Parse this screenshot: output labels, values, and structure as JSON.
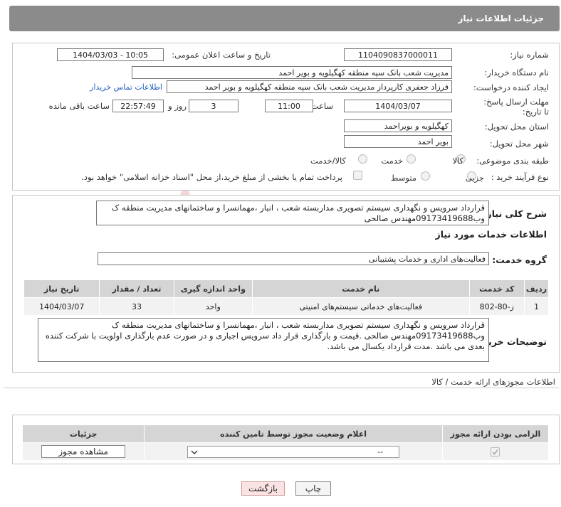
{
  "header": {
    "title": "جزئیات اطلاعات نیاز"
  },
  "form": {
    "need_number_label": "شماره نیاز:",
    "need_number": "1104090837000011",
    "announce_label": "تاریخ و ساعت اعلان عمومی:",
    "announce_value": "1404/03/03 - 10:05",
    "buyer_org_label": "نام دستگاه خریدار:",
    "buyer_org": "مدیریت شعب بانک سپه منطقه کهگیلویه و بویر احمد",
    "requester_label": "ایجاد کننده درخواست:",
    "requester": "فرزاد جعفری کارپرداز مدیریت شعب بانک سپه منطقه کهگیلویه و بویر احمد",
    "contact_link": "اطلاعات تماس خریدار",
    "deadline_label": "مهلت ارسال پاسخ: تا تاریخ:",
    "deadline_date": "1404/03/07",
    "time_label": "ساعت",
    "deadline_time": "11:00",
    "days_value": "3",
    "days_label": "روز و",
    "remaining_time": "22:57:49",
    "remaining_label": "ساعت باقی مانده",
    "province_label": "استان محل تحویل:",
    "province": "کهگیلویه و بویراحمد",
    "city_label": "شهر محل تحویل:",
    "city": "بویر احمد",
    "category_label": "طبقه بندی موضوعی:",
    "category_options": [
      "کالا",
      "خدمت",
      "کالا/خدمت"
    ],
    "process_label": "نوع فرآیند خرید :",
    "process_options": [
      "جزیی",
      "متوسط"
    ],
    "payment_note": "پرداخت تمام یا بخشی از مبلغ خرید،از محل \"اسناد خزانه اسلامی\" خواهد بود."
  },
  "description": {
    "label": "شرح کلی نیاز:",
    "text": "قرارداد سرویس و نگهداری سیستم تصویری مداربسته شعب ، انبار ،مهمانسرا و ساختمانهای مدیریت منطقه ک وب09173419688مهندس صالحی"
  },
  "services": {
    "section_title": "اطلاعات خدمات مورد نیاز",
    "group_label": "گروه خدمت:",
    "group_value": "فعالیت‌های اداری و خدمات پشتیبانی",
    "columns": [
      "ردیف",
      "کد خدمت",
      "نام خدمت",
      "واحد اندازه گیری",
      "تعداد / مقدار",
      "تاریخ نیاز"
    ],
    "rows": [
      {
        "idx": "1",
        "code": "ز-80-802",
        "name": "فعالیت‌های خدماتی سیستم‌های امنیتی",
        "unit": "واحد",
        "qty": "33",
        "date": "1404/03/07"
      }
    ]
  },
  "buyer_notes": {
    "label": "توضیحات خریدار:",
    "text": "قرارداد سرویس و نگهداری سیستم تصویری مداربسته شعب ، انبار ،مهمانسرا و ساختمانهای مدیریت منطقه ک وب09173419688مهندس صالحی .قیمت و بارگذاری قرار داد سرویس اجباری و در صورت عدم بارگذاری اولویت با شرکت کننده بعدی می باشد .مدت قرارداد یکسال می باشد."
  },
  "permits": {
    "section_title": "اطلاعات مجوزهای ارائه خدمت / کالا",
    "columns": [
      "الزامی بودن ارائه مجوز",
      "اعلام وضعیت مجوز توسط تامین کننده",
      "جزئیات"
    ],
    "select_value": "--",
    "view_button": "مشاهده مجوز"
  },
  "actions": {
    "print": "چاپ",
    "back": "بازگشت"
  },
  "watermark": {
    "text": "AriaTender.net"
  }
}
